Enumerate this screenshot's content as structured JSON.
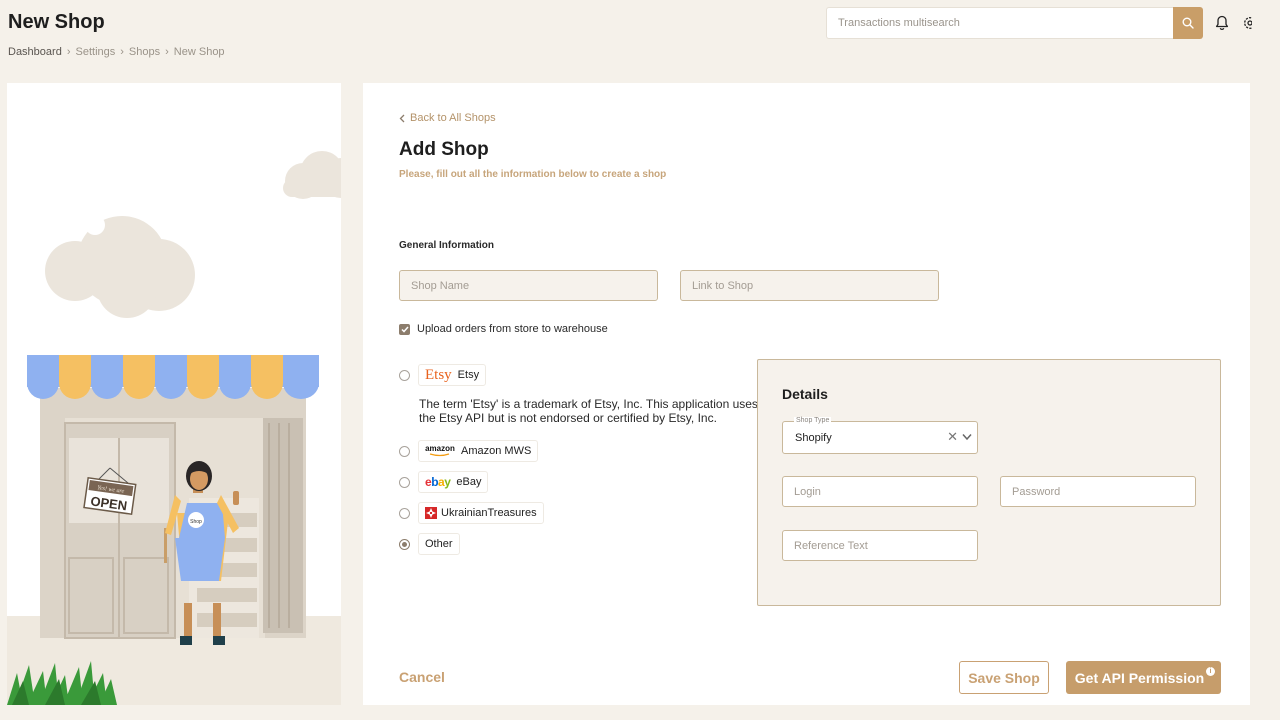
{
  "header": {
    "title": "New Shop",
    "breadcrumb": [
      "Dashboard",
      "Settings",
      "Shops",
      "New Shop"
    ],
    "search_placeholder": "Transactions multisearch"
  },
  "illustration": {
    "sign_small": "Yes! we are",
    "sign_text": "OPEN",
    "apron_text": "Shop"
  },
  "form": {
    "back_label": "Back to All Shops",
    "title": "Add Shop",
    "subtitle": "Please, fill out all the information below to create a shop",
    "section_label": "General Information",
    "shop_name_placeholder": "Shop Name",
    "link_placeholder": "Link to Shop",
    "checkbox_label": "Upload orders from store to warehouse",
    "checkbox_checked": true
  },
  "platforms": {
    "etsy": {
      "logo": "Etsy",
      "label": "Etsy"
    },
    "etsy_note": "The term 'Etsy' is a trademark of Etsy, Inc. This application uses the Etsy API but is not endorsed or certified by Etsy, Inc.",
    "amazon": {
      "logo": "amazon",
      "label": "Amazon MWS"
    },
    "ebay": {
      "label": "eBay"
    },
    "ukrainian": {
      "label": "UkrainianTreasures"
    },
    "other": {
      "label": "Other"
    },
    "selected": "other"
  },
  "details": {
    "title": "Details",
    "shop_type_label": "Shop Type",
    "shop_type_value": "Shopify",
    "clear_glyph": "✕",
    "login_placeholder": "Login",
    "password_placeholder": "Password",
    "reference_placeholder": "Reference Text"
  },
  "actions": {
    "cancel": "Cancel",
    "save": "Save Shop",
    "api": "Get API Permission",
    "info_glyph": "i"
  },
  "colors": {
    "background": "#f5f1ea",
    "accent": "#c69d6b",
    "accent_text": "#c9a173",
    "panel": "#f6f2ec",
    "border": "#c9b89b"
  }
}
